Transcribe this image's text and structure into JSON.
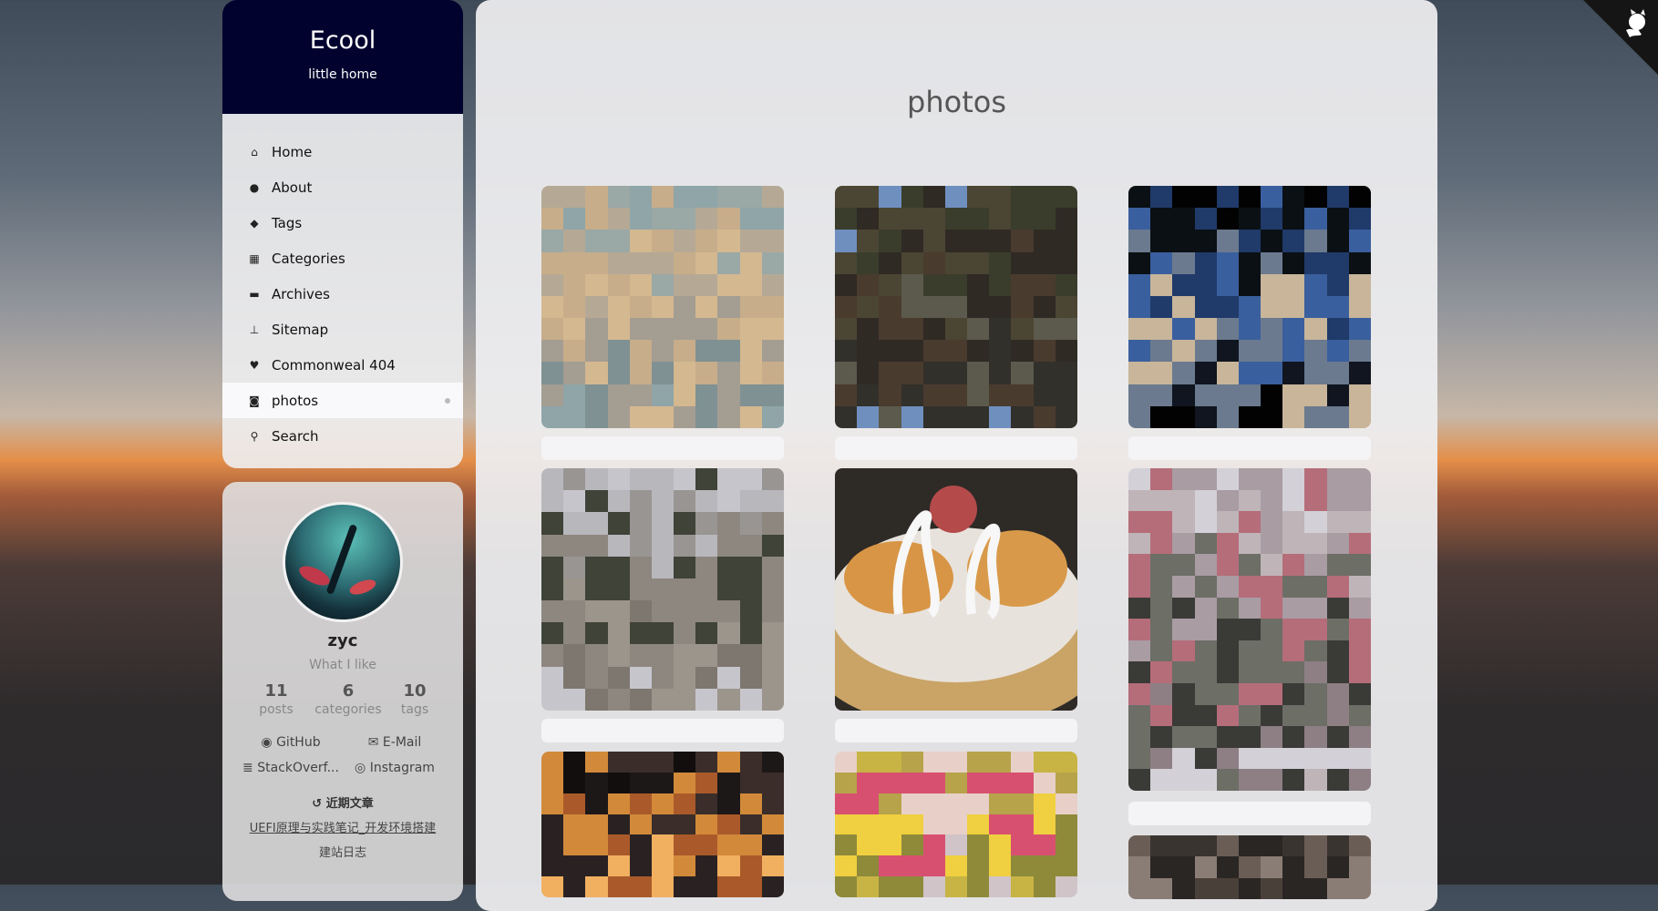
{
  "brand": {
    "title": "Ecool",
    "subtitle": "little home"
  },
  "menu": [
    {
      "icon": "home-icon",
      "glyph": "⌂",
      "label": "Home"
    },
    {
      "icon": "user-icon",
      "glyph": "●",
      "label": "About"
    },
    {
      "icon": "tags-icon",
      "glyph": "◆",
      "label": "Tags"
    },
    {
      "icon": "grid-icon",
      "glyph": "▦",
      "label": "Categories"
    },
    {
      "icon": "archive-icon",
      "glyph": "▬",
      "label": "Archives"
    },
    {
      "icon": "sitemap-icon",
      "glyph": "⊥",
      "label": "Sitemap"
    },
    {
      "icon": "heartbeat-icon",
      "glyph": "♥",
      "label": "Commonweal 404"
    },
    {
      "icon": "camera-icon",
      "glyph": "◙",
      "label": "photos",
      "active": true
    },
    {
      "icon": "search-icon",
      "glyph": "⚲",
      "label": "Search"
    }
  ],
  "profile": {
    "name": "zyc",
    "description": "What I like",
    "stats": [
      {
        "num": "11",
        "label": "posts"
      },
      {
        "num": "6",
        "label": "categories"
      },
      {
        "num": "10",
        "label": "tags"
      }
    ],
    "links": [
      {
        "icon": "github-icon",
        "label": "GitHub"
      },
      {
        "icon": "envelope-icon",
        "label": "E-Mail"
      },
      {
        "icon": "stackoverflow-icon",
        "label": "StackOverf..."
      },
      {
        "icon": "instagram-icon",
        "label": "Instagram"
      }
    ],
    "recent_title": "近期文章",
    "recent_links": [
      "UEFI原理与实践笔记_开发环境搭建",
      "建站日志"
    ]
  },
  "page": {
    "title": "photos"
  },
  "colors": {
    "brand_bg": "#02022f",
    "main_bg": "#ededef"
  }
}
